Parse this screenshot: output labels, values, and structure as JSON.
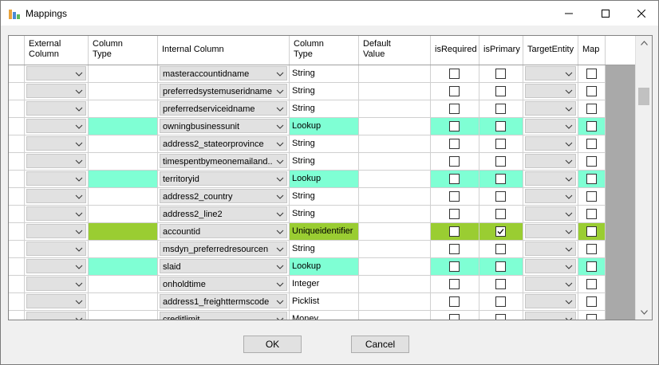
{
  "window": {
    "title": "Mappings",
    "minimize_icon": "minimize-icon",
    "maximize_icon": "maximize-icon",
    "close_icon": "close-icon"
  },
  "headers": {
    "external_column": "External\nColumn",
    "column_type": "Column\nType",
    "internal_column": "Internal Column",
    "column_type2": "Column\nType",
    "default_value": "Default\nValue",
    "is_required": "isRequired",
    "is_primary": "isPrimary",
    "target_entity": "TargetEntity",
    "map": "Map"
  },
  "colors": {
    "lookup": "#7fffd4",
    "primary": "#9acd32",
    "combo": "#e1e1e1"
  },
  "rows": [
    {
      "internal": "masteraccountidname",
      "type": "String",
      "highlight": "none",
      "is_primary": false
    },
    {
      "internal": "preferredsystemuseridname",
      "type": "String",
      "highlight": "none",
      "is_primary": false
    },
    {
      "internal": "preferredserviceidname",
      "type": "String",
      "highlight": "none",
      "is_primary": false
    },
    {
      "internal": "owningbusinessunit",
      "type": "Lookup",
      "highlight": "lookup",
      "is_primary": false
    },
    {
      "internal": "address2_stateorprovince",
      "type": "String",
      "highlight": "none",
      "is_primary": false
    },
    {
      "internal": "timespentbymeonemailand...",
      "type": "String",
      "highlight": "none",
      "is_primary": false
    },
    {
      "internal": "territoryid",
      "type": "Lookup",
      "highlight": "lookup",
      "is_primary": false
    },
    {
      "internal": "address2_country",
      "type": "String",
      "highlight": "none",
      "is_primary": false
    },
    {
      "internal": "address2_line2",
      "type": "String",
      "highlight": "none",
      "is_primary": false
    },
    {
      "internal": "accountid",
      "type": "Uniqueidentifier",
      "highlight": "primary",
      "is_primary": true
    },
    {
      "internal": "msdyn_preferredresourcen",
      "type": "String",
      "highlight": "none",
      "is_primary": false
    },
    {
      "internal": "slaid",
      "type": "Lookup",
      "highlight": "lookup",
      "is_primary": false
    },
    {
      "internal": "onholdtime",
      "type": "Integer",
      "highlight": "none",
      "is_primary": false
    },
    {
      "internal": "address1_freighttermscode",
      "type": "Picklist",
      "highlight": "none",
      "is_primary": false
    },
    {
      "internal": "creditlimit",
      "type": "Money",
      "highlight": "none",
      "is_primary": false
    }
  ],
  "scroll": {
    "up_icon": "chevron-up-icon",
    "down_icon": "chevron-down-icon"
  },
  "buttons": {
    "ok": "OK",
    "cancel": "Cancel"
  }
}
